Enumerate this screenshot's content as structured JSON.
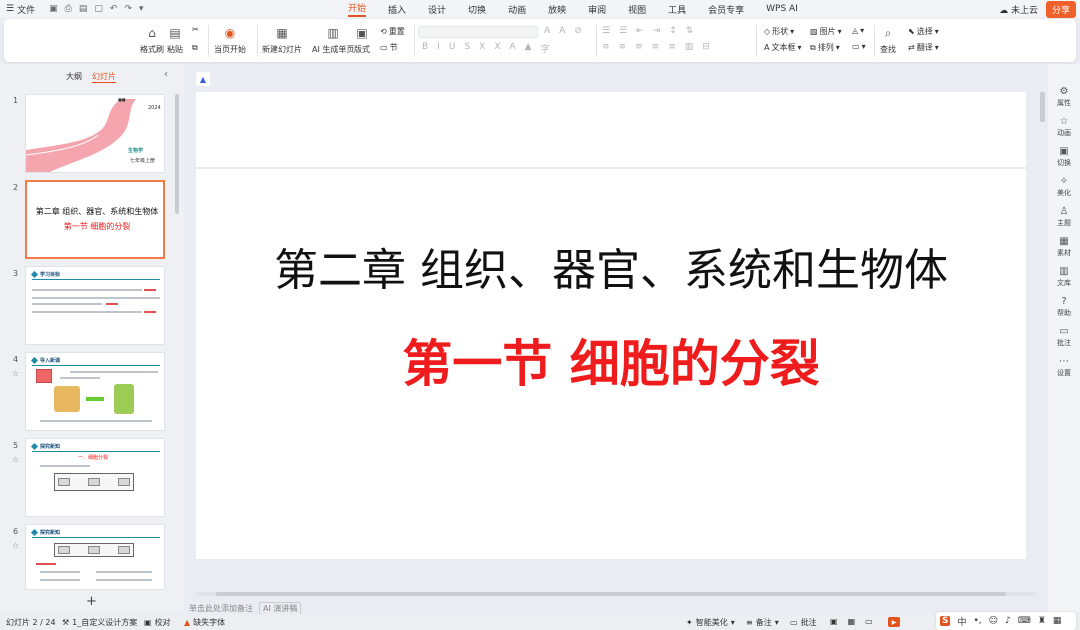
{
  "menubar": {
    "file_label": "文件",
    "tabs": [
      "开始",
      "插入",
      "设计",
      "切换",
      "动画",
      "放映",
      "审阅",
      "视图",
      "工具",
      "会员专享",
      "WPS AI"
    ],
    "active_tab": "开始",
    "cloud_label": "未上云",
    "share_label": "分享"
  },
  "ribbon": {
    "format_painter": "格式刷",
    "paste": "粘贴",
    "play_from_current": "当页开始",
    "new_slide": "新建幻灯片",
    "ai_generate": "AI 生成单页",
    "layout": "版式",
    "reset": "重置",
    "section": "节",
    "shape": "形状",
    "picture": "图片",
    "textbox": "文本框",
    "arrange": "排列",
    "find": "查找",
    "select": "选择",
    "translate": "翻译"
  },
  "left_panel": {
    "tab_outline": "大纲",
    "tab_slides": "幻灯片",
    "thumbnails": [
      {
        "num": "1",
        "year": "2024",
        "author": "生物学",
        "grade": "七年级上册"
      },
      {
        "num": "2",
        "title": "第二章 组织、器官、系统和生物体",
        "subtitle": "第一节 细胞的分裂"
      },
      {
        "num": "3",
        "heading": "学习目标"
      },
      {
        "num": "4",
        "heading": "导入新课"
      },
      {
        "num": "5",
        "heading": "探究新知",
        "red": "一、细胞分裂"
      },
      {
        "num": "6",
        "heading": "探究新知"
      }
    ]
  },
  "slide": {
    "title": "第二章 组织、器官、系统和生物体",
    "subtitle": "第一节  细胞的分裂"
  },
  "notes": {
    "placeholder": "单击此处添加备注",
    "ai_label": "AI 演讲稿"
  },
  "right_sidebar": [
    "属性",
    "动画",
    "切换",
    "美化",
    "主题",
    "素材",
    "文库",
    "帮助",
    "批注",
    "设置"
  ],
  "statusbar": {
    "slide_count": "幻灯片 2 / 24",
    "theme": "1_自定义设计方案",
    "proofread": "校对",
    "missing_font": "缺失字体",
    "smart_beautify": "智能美化",
    "notes": "备注",
    "comments": "批注"
  },
  "ime": {
    "lang": "中"
  }
}
